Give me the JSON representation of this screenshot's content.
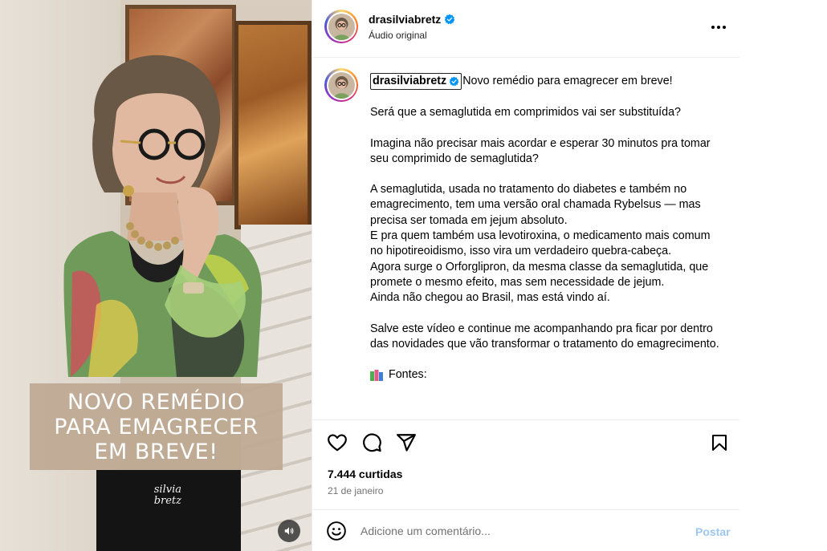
{
  "post": {
    "username": "drasilviabretz",
    "verified": true,
    "subtitle": "Áudio original",
    "more_icon": "more-horizontal-icon"
  },
  "media": {
    "overlay_lines": [
      "NOVO REMÉDIO",
      "PARA EMAGRECER",
      "EM BREVE!"
    ],
    "watermark": "silvia\nbretz",
    "mute_icon": "speaker-icon",
    "overlay_color": "#bea892"
  },
  "caption": {
    "username": "drasilviabretz",
    "first_line": "Novo remédio para emagrecer em breve!",
    "paragraphs": [
      [
        "Será que a semaglutida em comprimidos vai ser substituída?"
      ],
      [
        "Imagina não precisar mais acordar e esperar 30 minutos pra tomar seu comprimido de semaglutida?"
      ],
      [
        "A semaglutida, usada no tratamento do diabetes e também no emagrecimento, tem uma versão oral chamada Rybelsus — mas precisa ser tomada em jejum absoluto.",
        "E pra quem também usa levotiroxina, o medicamento mais comum no hipotireoidismo, isso vira um verdadeiro quebra-cabeça.",
        "Agora surge o Orforglipron, da mesma classe da semaglutida, que promete o mesmo efeito, mas sem necessidade de jejum.",
        "Ainda não chegou ao Brasil, mas está vindo aí."
      ],
      [
        "Salve este vídeo e continue me acompanhando pra ficar por dentro das novidades que vão transformar o tratamento do emagrecimento."
      ]
    ],
    "sources_label": "Fontes:",
    "sources_icon": "books-icon"
  },
  "actions": {
    "like_icon": "heart-icon",
    "comment_icon": "comment-icon",
    "share_icon": "share-icon",
    "save_icon": "bookmark-icon"
  },
  "stats": {
    "likes": "7.444 curtidas",
    "date": "21 de janeiro"
  },
  "comment": {
    "placeholder": "Adicione um comentário...",
    "post_label": "Postar",
    "emoji_icon": "emoji-icon"
  },
  "colors": {
    "verified": "#0095f6",
    "post_button": "#9cc7f0",
    "secondary_text": "#737373"
  }
}
